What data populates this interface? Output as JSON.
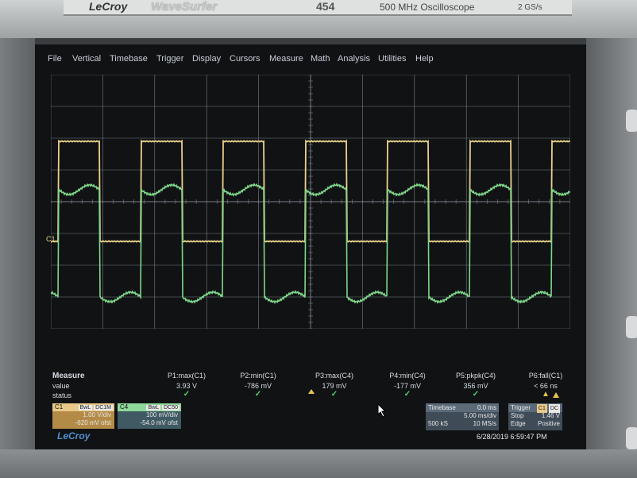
{
  "brand": {
    "lecroy": "LeCroy",
    "product": "WaveSurfer",
    "model": "454",
    "desc": "500 MHz Oscilloscope",
    "sample_rate": "2 GS/s"
  },
  "menu": [
    "File",
    "Vertical",
    "Timebase",
    "Trigger",
    "Display",
    "Cursors",
    "Measure",
    "Math",
    "Analysis",
    "Utilities",
    "Help"
  ],
  "channel_marker": "C1",
  "colors": {
    "c1": "#ead28a",
    "c4": "#7fd88a",
    "grid": "#7a7f86"
  },
  "measure": {
    "title": "Measure",
    "value_label": "value",
    "status_label": "status",
    "params": [
      {
        "name": "P1:max(C1)",
        "value": "3.93 V",
        "status": "✓"
      },
      {
        "name": "P2:min(C1)",
        "value": "-786 mV",
        "status": "✓"
      },
      {
        "name": "P3:max(C4)",
        "value": "179 mV",
        "status": "✓"
      },
      {
        "name": "P4:min(C4)",
        "value": "-177 mV",
        "status": "✓"
      },
      {
        "name": "P5:pkpk(C4)",
        "value": "356 mV",
        "status": "✓"
      },
      {
        "name": "P6:fall(C1)",
        "value": "< 66 ns",
        "status": "▲"
      }
    ]
  },
  "c1": {
    "name": "C1",
    "tag1": "BwL",
    "tag2": "DC1M",
    "vdiv": "1.00 V/div",
    "offset": "-620 mV ofst"
  },
  "c4": {
    "name": "C4",
    "tag1": "BwL",
    "tag2": "DC50",
    "vdiv": "100 mV/div",
    "offset": "-54.0 mV ofst"
  },
  "timebase": {
    "label": "Timebase",
    "delay": "0.0 ms",
    "tdiv": "5.00 ms/div",
    "samples": "500 kS",
    "rate": "10 MS/s"
  },
  "trigger": {
    "label": "Trigger",
    "chan1": "C1",
    "chan2": "DC",
    "mode": "Stop",
    "level": "1.46 V",
    "type": "Edge",
    "slope": "Positive"
  },
  "logo": "LeCroy",
  "datetime": "6/28/2019 6:59:47 PM"
}
